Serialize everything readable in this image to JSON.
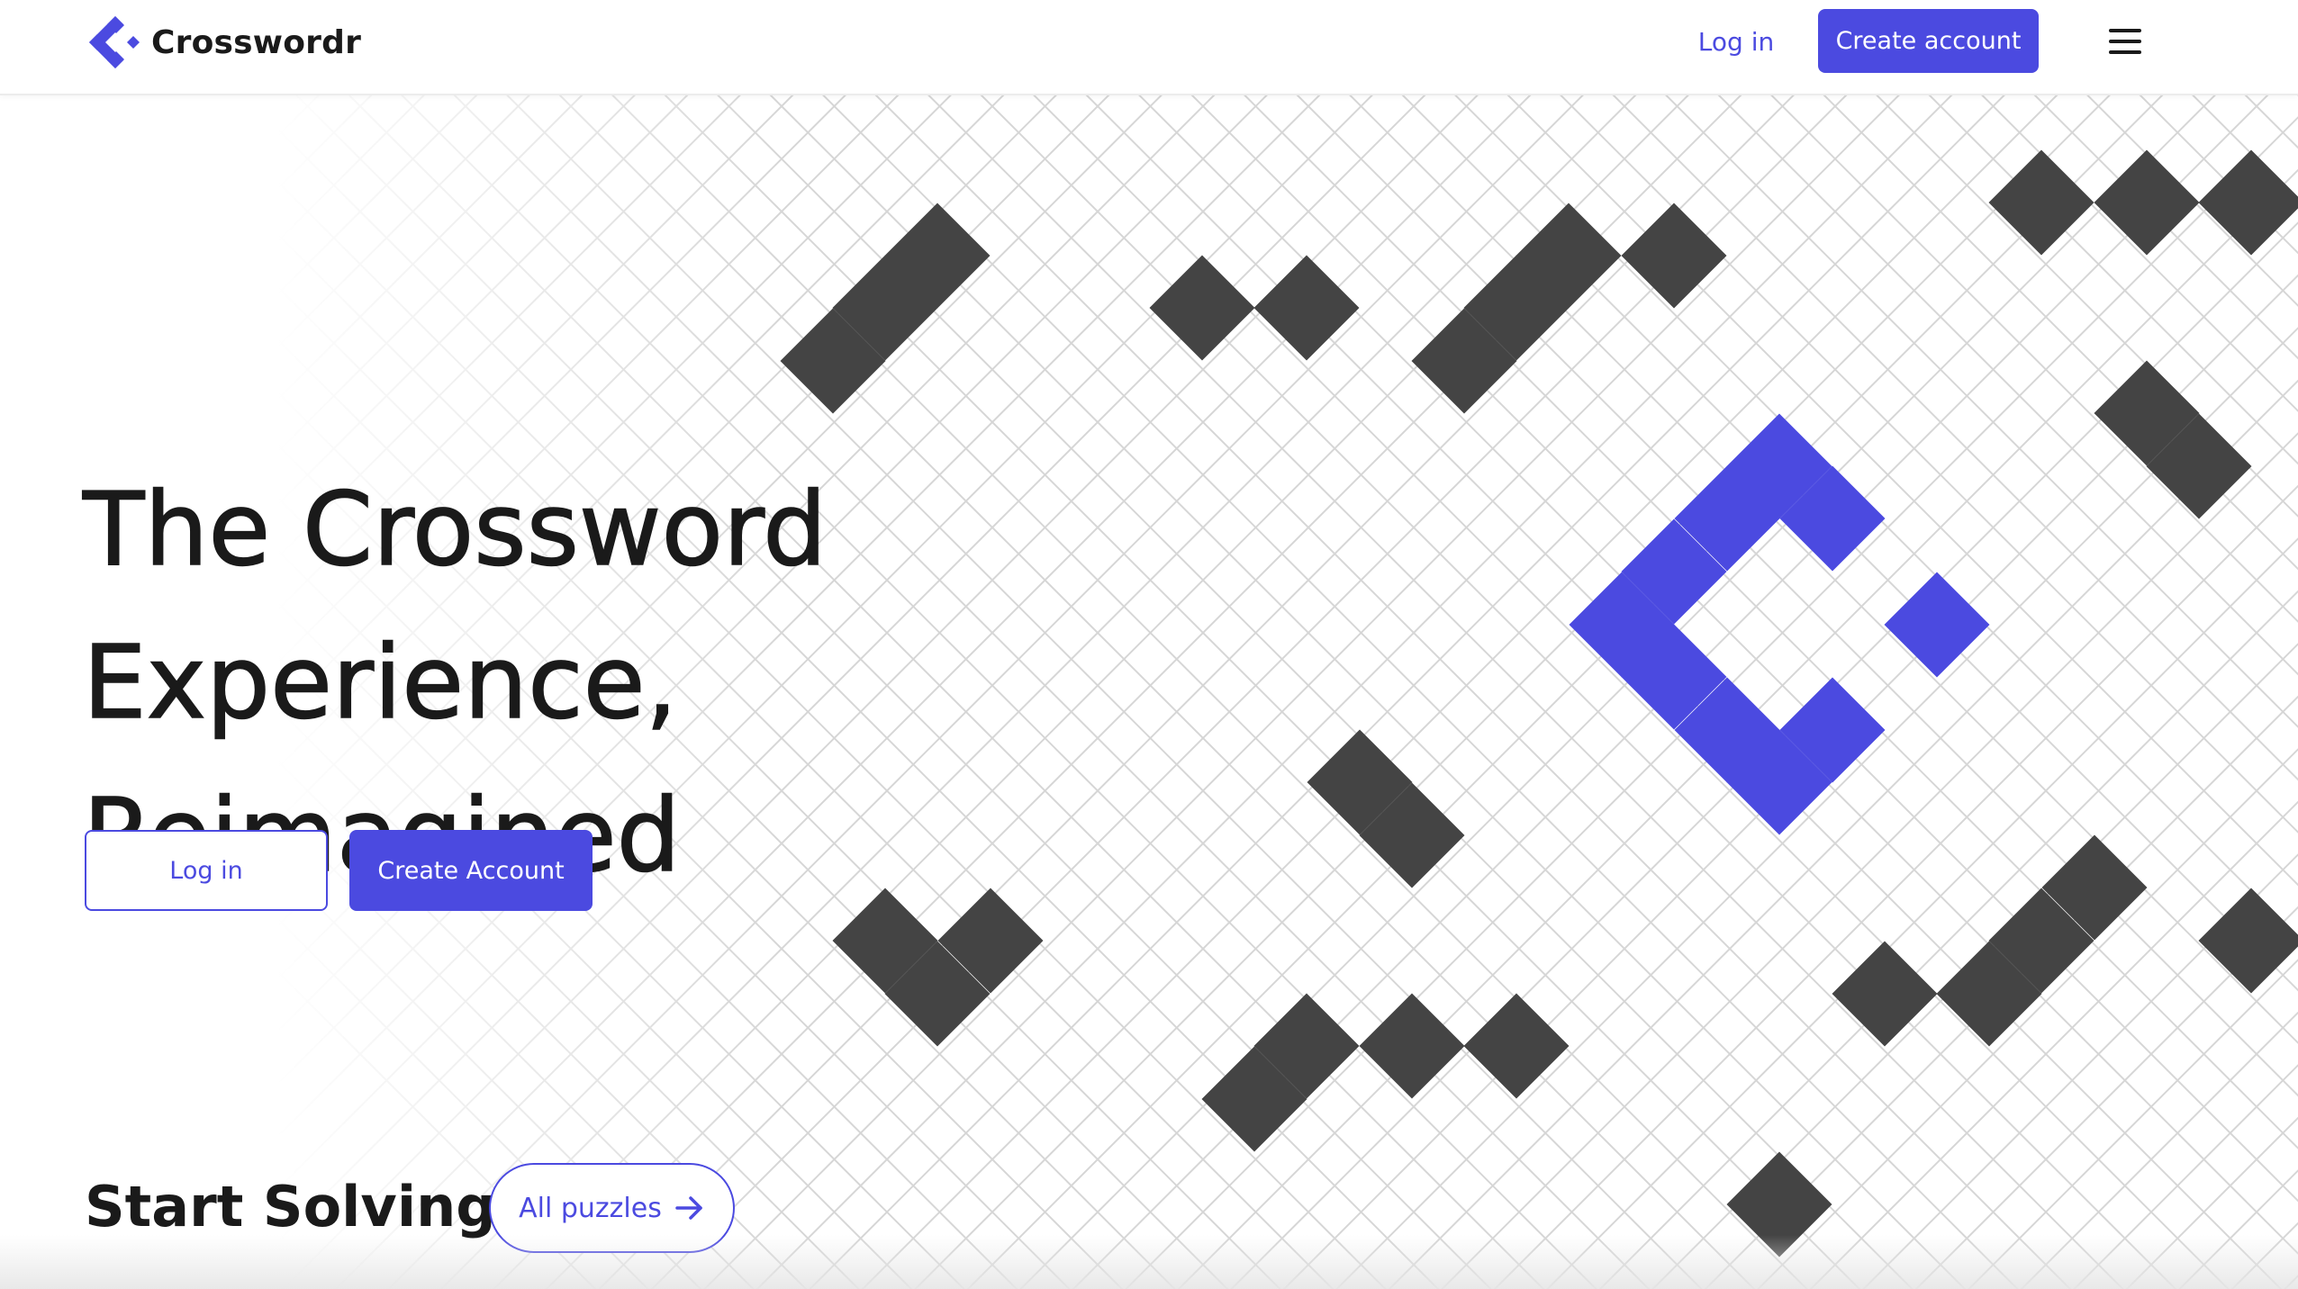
{
  "header": {
    "brand": "Crosswordr",
    "login_label": "Log in",
    "create_label": "Create account"
  },
  "hero": {
    "title_line1": "The Crossword Experience,",
    "title_line2": "Reimagined",
    "login_label": "Log in",
    "create_label": "Create Account"
  },
  "section": {
    "title": "Start Solving",
    "all_puzzles_label": "All puzzles"
  },
  "colors": {
    "accent": "#4b4ae0",
    "dark_cell": "#444444",
    "grid_line": "#d6d6d6",
    "text": "#1a1a1a"
  },
  "icons": {
    "logo": "crosswordr-logo-icon",
    "menu": "hamburger-menu-icon",
    "arrow": "arrow-right-icon"
  }
}
